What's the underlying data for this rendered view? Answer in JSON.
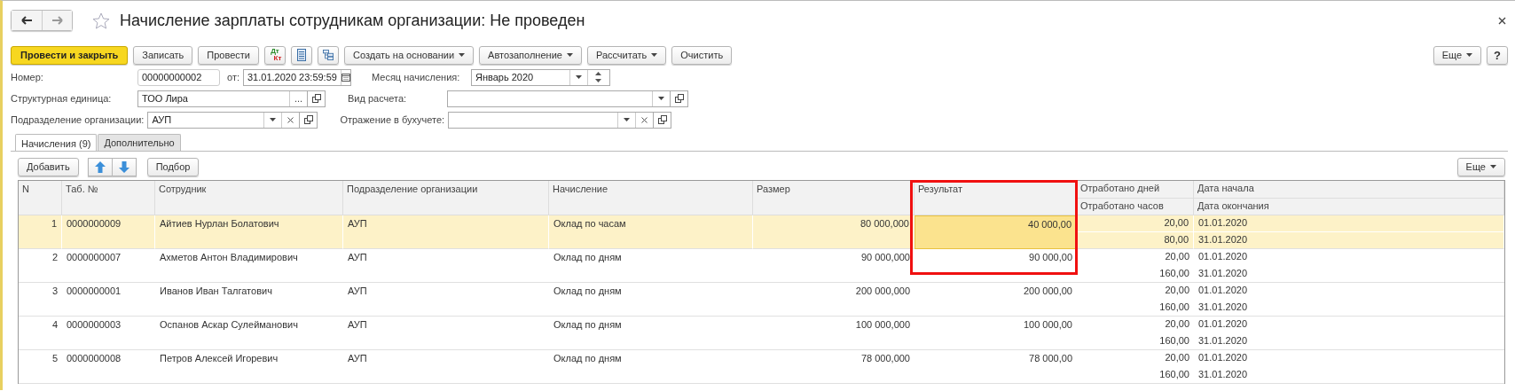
{
  "window": {
    "title": "Начисление зарплаты сотрудникам организации: Не проведен",
    "favorite": false
  },
  "toolbar": [
    {
      "kind": "primary",
      "label": "Провести и закрыть"
    },
    {
      "kind": "button",
      "label": "Записать"
    },
    {
      "kind": "button",
      "label": "Провести"
    },
    {
      "kind": "dtkt",
      "label": "Дт",
      "label2": "Кт"
    },
    {
      "kind": "list"
    },
    {
      "kind": "structure"
    },
    {
      "kind": "menu",
      "label": "Создать на основании"
    },
    {
      "kind": "menu",
      "label": "Автозаполнение"
    },
    {
      "kind": "menu",
      "label": "Рассчитать"
    },
    {
      "kind": "button",
      "label": "Очистить"
    }
  ],
  "toolbar_right": {
    "more": "Еще",
    "help": "?"
  },
  "form": {
    "number_label": "Номер:",
    "number": "00000000002",
    "date_label": "от:",
    "date": "31.01.2020 23:59:59",
    "month_label": "Месяц начисления:",
    "month": "Январь 2020",
    "unit_label": "Структурная единица:",
    "unit": "ТОО  Лира",
    "unit_choose": "...",
    "calc_label": "Вид расчета:",
    "department_label": "Подразделение организации:",
    "department": "АУП",
    "accounting_label": "Отражение в бухучете:"
  },
  "tabs": [
    {
      "label": "Начисления (9)",
      "selected": true
    },
    {
      "label": "Дополнительно",
      "selected": false
    }
  ],
  "table_toolbar": {
    "add": "Добавить",
    "pick": "Подбор",
    "more": "Еще"
  },
  "table": {
    "columns": [
      "N",
      "Таб. №",
      "Сотрудник",
      "Подразделение организации",
      "Начисление",
      "Размер",
      "Результат",
      [
        "Отработано дней",
        "Отработано часов"
      ],
      [
        "Дата начала",
        "Дата окончания"
      ]
    ],
    "rows": [
      {
        "selected": true,
        "focused_result": true,
        "n": "1",
        "tab": "0000000009",
        "employee": "Айтиев Нурлан Болатович",
        "department": "АУП",
        "accrual": "Оклад по часам",
        "size": "80 000,000",
        "result": "40 000,00",
        "days": "20,00",
        "hours": "80,00",
        "start": "01.01.2020",
        "end": "31.01.2020"
      },
      {
        "selected": false,
        "focused_result": false,
        "n": "2",
        "tab": "0000000007",
        "employee": "Ахметов Антон Владимирович",
        "department": "АУП",
        "accrual": "Оклад по дням",
        "size": "90 000,000",
        "result": "90 000,00",
        "days": "20,00",
        "hours": "160,00",
        "start": "01.01.2020",
        "end": "31.01.2020"
      },
      {
        "selected": false,
        "focused_result": false,
        "n": "3",
        "tab": "0000000001",
        "employee": "Иванов Иван Талгатович",
        "department": "АУП",
        "accrual": "Оклад по дням",
        "size": "200 000,000",
        "result": "200 000,00",
        "days": "20,00",
        "hours": "160,00",
        "start": "01.01.2020",
        "end": "31.01.2020"
      },
      {
        "selected": false,
        "focused_result": false,
        "n": "4",
        "tab": "0000000003",
        "employee": "Оспанов Аскар Сулейманович",
        "department": "АУП",
        "accrual": "Оклад по дням",
        "size": "100 000,000",
        "result": "100 000,00",
        "days": "20,00",
        "hours": "160,00",
        "start": "01.01.2020",
        "end": "31.01.2020"
      },
      {
        "selected": false,
        "focused_result": false,
        "n": "5",
        "tab": "0000000008",
        "employee": "Петров Алексей Игоревич",
        "department": "АУП",
        "accrual": "Оклад по дням",
        "size": "78 000,000",
        "result": "78 000,00",
        "days": "20,00",
        "hours": "160,00",
        "start": "01.01.2020",
        "end": "31.01.2020"
      }
    ]
  }
}
